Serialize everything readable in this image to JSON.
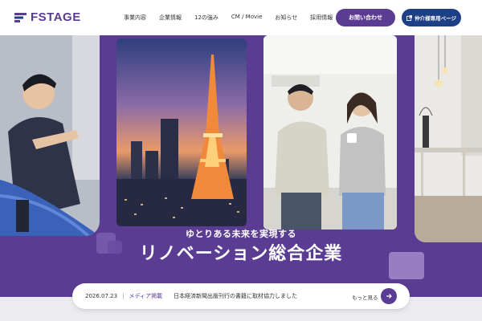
{
  "header": {
    "brand": "FSTAGE",
    "nav": [
      "事業内容",
      "企業情報",
      "12の強み",
      "CM / Movie",
      "お知らせ",
      "採用情報"
    ],
    "contact_label": "お問い合わせ",
    "agent_label": "仲介様専用ページ"
  },
  "hero": {
    "subcopy": "ゆとりある未来を実現する",
    "maincopy": "リノベーション総合企業"
  },
  "news": {
    "date": "2026.07.23",
    "separator": "|",
    "category": "メディア掲載",
    "title": "日本経済新聞出版刊行の書籍に取材協力しました",
    "more_label": "もっと見る"
  },
  "colors": {
    "brand_purple": "#5b3c93",
    "navy": "#1c3f86"
  }
}
